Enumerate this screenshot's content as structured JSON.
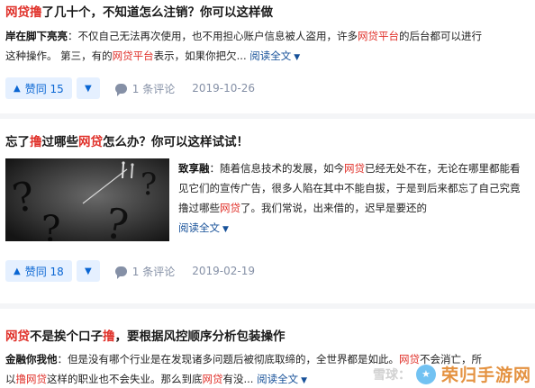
{
  "articles": [
    {
      "title": [
        "网贷撸",
        "了几十个，不知道怎么注销？你可以这样做"
      ],
      "excerpt_line1": [
        "岸在脚下亮亮",
        "：不仅自己无法再次使用，也不用担心账户信息被人盗用，许多",
        "网贷平台",
        "的后台都可以进行"
      ],
      "excerpt_line2": [
        "这种操作。 第三，有的",
        "网贷平台",
        "表示，如果你把欠...",
        "阅读全文"
      ],
      "vote_label": "赞同 15",
      "comment_label": "1 条评论",
      "date": "2019-10-26"
    },
    {
      "title": [
        "忘了",
        "撸",
        "过哪些",
        "网贷",
        "怎么办？你可以这样试试！"
      ],
      "excerpt": [
        "致享融",
        "：随着信息技术的发展，如今",
        "网贷",
        "已经无处不在，无论在哪里都能看见它们的宣传广告，很多人陷在其中不能自拔，于是到后来都忘了自己究竟撸过哪些",
        "网贷",
        "了。我们常说，出来借的，迟早是要还的"
      ],
      "read_more": "阅读全文",
      "vote_label": "赞同 18",
      "comment_label": "1 条评论",
      "date": "2019-02-19"
    },
    {
      "title": [
        "网贷",
        "不是挨个口子",
        "撸",
        "，要根据风控顺序分析包装操作"
      ],
      "excerpt_line1": [
        "金融你我他",
        "：但是没有哪个行业是在发现诸多问题后被彻底取缔的，全世界都是如此。",
        "网贷",
        "不会消亡，所"
      ],
      "excerpt_line2": [
        "以",
        "撸网贷",
        "这样的职业也不会失业。那么到底",
        "网贷",
        "有没...",
        "阅读全文"
      ]
    }
  ],
  "icons": {
    "vote_up": "triangle-up-icon",
    "vote_down": "triangle-down-icon",
    "comment": "comment-bubble-icon",
    "chevron": "chevron-down-icon"
  },
  "colors": {
    "highlight": "#e0322b",
    "link": "#175199",
    "vote_bg": "#e5f0ff",
    "vote_text": "#0a66d3",
    "meta": "#8590a6"
  },
  "watermark": {
    "left": "雪球：",
    "right": "荣归手游网"
  }
}
